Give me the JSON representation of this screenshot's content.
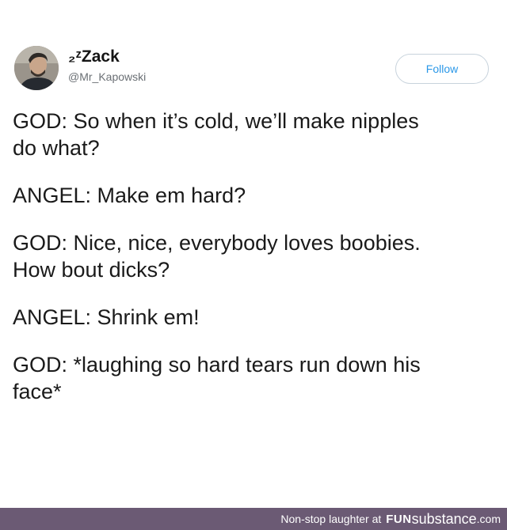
{
  "tweet": {
    "author": {
      "display_name": "₂ᶻZack",
      "handle": "@Mr_Kapowski"
    },
    "follow_label": "Follow",
    "paragraphs": [
      {
        "lines": [
          "GOD: So when it’s cold, we’ll make nipples",
          "do what?"
        ]
      },
      {
        "lines": [
          "ANGEL: Make em hard?"
        ]
      },
      {
        "lines": [
          "GOD: Nice, nice, everybody loves boobies.",
          "How bout dicks?"
        ]
      },
      {
        "lines": [
          "ANGEL: Shrink em!"
        ]
      },
      {
        "lines": [
          "GOD: *laughing so hard tears run down his",
          "face*"
        ]
      }
    ]
  },
  "footer": {
    "tagline": "Non-stop laughter at",
    "brand_fun": "FUN",
    "brand_substance": "substance",
    "brand_tld": ".com"
  },
  "colors": {
    "follow_text": "#2b98e8",
    "footer_bg": "#6b5a74"
  },
  "icons": {
    "avatar": "profile-photo"
  }
}
